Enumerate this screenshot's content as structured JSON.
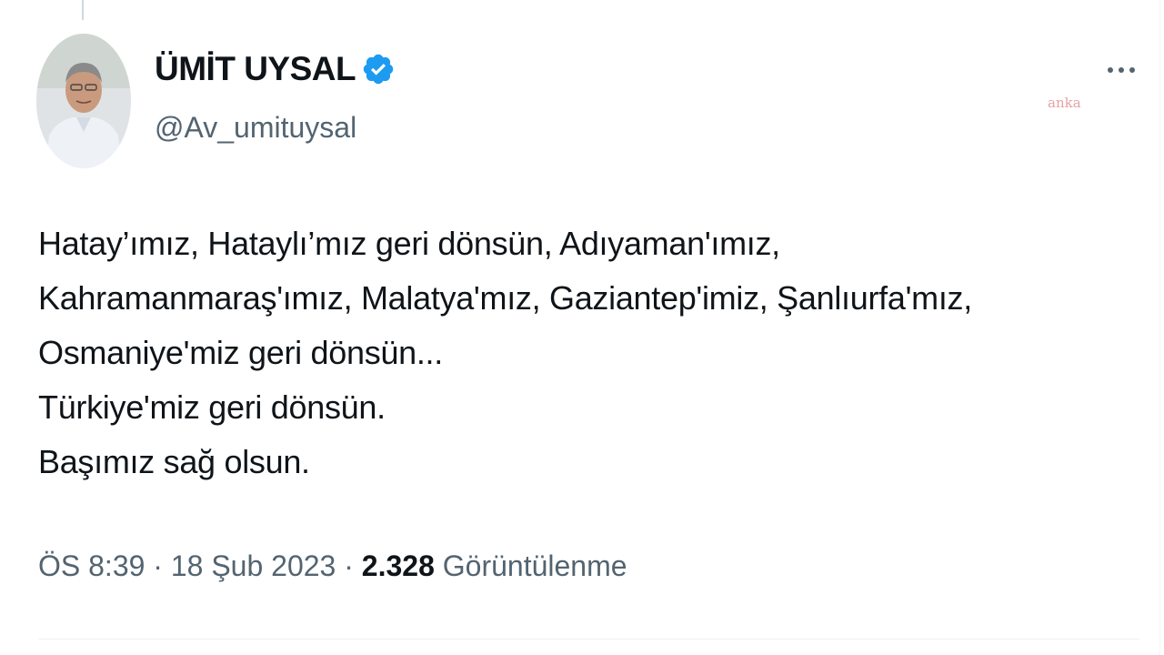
{
  "author": {
    "display_name": "ÜMİT UYSAL",
    "handle": "@Av_umituysal",
    "verified": true,
    "verified_color": "#1d9bf0"
  },
  "tweet": {
    "lines": [
      "Hatay’ımız, Hataylı’mız geri dönsün, Adıyaman'ımız,",
      "Kahramanmaraş'ımız, Malatya'mız, Gaziantep'imiz, Şanlıurfa'mız,",
      "Osmaniye'miz geri dönsün...",
      "Türkiye'miz geri dönsün.",
      "Başımız sağ olsun."
    ]
  },
  "meta": {
    "time": "ÖS 8:39",
    "separator": " · ",
    "date": "18 Şub 2023",
    "views_count": "2.328",
    "views_label": " Görüntülenme"
  },
  "icons": {
    "more": "more-horizontal-icon",
    "verified": "verified-badge-icon"
  },
  "colors": {
    "text_primary": "#0f1419",
    "text_secondary": "#536471",
    "accent": "#1d9bf0"
  }
}
